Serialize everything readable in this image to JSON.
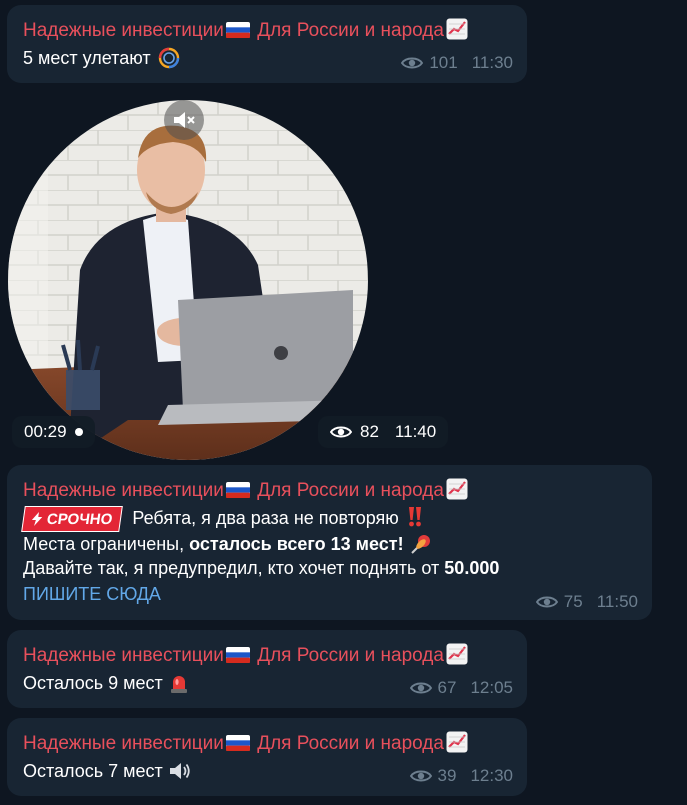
{
  "channel": {
    "name": "Надежные инвестиции",
    "name_suffix": "Для России и народа"
  },
  "colors": {
    "background": "#0e1621",
    "bubble": "#182533",
    "sender": "#e8505c",
    "meta": "#6d7f8f",
    "link": "#62a8e8",
    "urgent_badge": "#e32636"
  },
  "messages": [
    {
      "text": "5 мест улетают",
      "emoji": "loading-ring-icon",
      "views": "101",
      "time": "11:30"
    },
    {
      "type": "video_note",
      "duration": "00:29",
      "views": "82",
      "time": "11:40",
      "mute_icon": "muted-speaker-icon"
    },
    {
      "badge": "СРОЧНО",
      "line1": "Ребята, я два раза не повторяю",
      "line2_plain": "Места ограничены, ",
      "line2_bold": "осталось всего 13 мест!",
      "line3_plain": "Давайте так, я предупредил, кто хочет поднять от ",
      "line3_bold": "50.000",
      "link": "ПИШИТЕ СЮДА",
      "views": "75",
      "time": "11:50"
    },
    {
      "text": "Осталось 9 мест",
      "emoji": "siren-icon",
      "views": "67",
      "time": "12:05"
    },
    {
      "text": "Осталось 7 мест",
      "emoji": "speaker-icon",
      "views": "39",
      "time": "12:30"
    }
  ]
}
